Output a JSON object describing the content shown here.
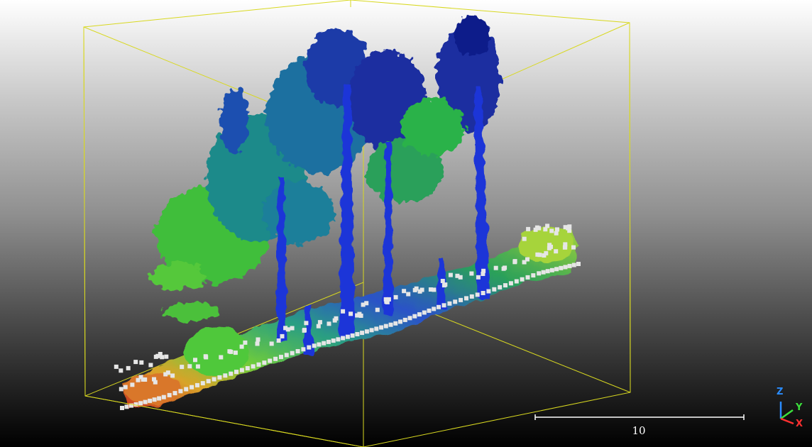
{
  "scene": {
    "bounding_box_color": "#d8d820",
    "ground_colors": [
      "#c8331e",
      "#d9a32a",
      "#a6c83a",
      "#4fc63a",
      "#2a9e82",
      "#2a52c8"
    ],
    "canopy_colors": [
      "#49c93a",
      "#2bb24a",
      "#1a8a8a",
      "#1550b4",
      "#1b2fa0",
      "#0e1d8a"
    ],
    "trunk_color": "#1b35d8",
    "marker_color": "#e6e6e6"
  },
  "scale_bar": {
    "value": "10"
  },
  "axes_gizmo": {
    "z": {
      "label": "Z",
      "color": "#2a8cff"
    },
    "y": {
      "label": "Y",
      "color": "#3ce03c"
    },
    "x": {
      "label": "X",
      "color": "#ff3030"
    }
  }
}
